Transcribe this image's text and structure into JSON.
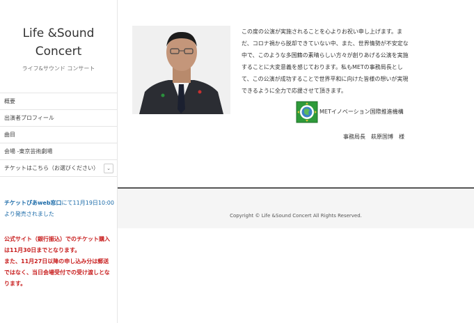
{
  "site": {
    "title": "Life &Sound Concert",
    "subtitle": "ライフ&サウンド コンサート"
  },
  "menu": {
    "items": [
      {
        "label": "概要"
      },
      {
        "label": "出演者プロフィール"
      },
      {
        "label": "曲目"
      },
      {
        "label": "会場 -東京芸術劇場"
      },
      {
        "label": "チケットはこちら（お選びください）",
        "toggle": "⌄"
      }
    ]
  },
  "notice_ticketpia": {
    "bold": "チケットぴあweb窓口",
    "rest": "にて11月19日10:00より発売されました"
  },
  "notice_official": {
    "line1": "公式サイト（銀行振込）でのチケット購入は11月30日までとなります。",
    "line2": "また、11月27日以降の申し込み分は郵送ではなく、当日会場受付での受け渡しとなります。"
  },
  "message": {
    "text": "この度の公演が実施されることを心よりお祝い申し上げます。まだ、コロナ禍から脱却できていない中、また、世界情勢が不安定な中で、このような多国籍の素晴らしい方々が創りあげる公演を実施することに大変意義を感じております。私もMETの事務局長として、この公演が成功することで世界平和に向けた皆様の想いが実現できるように全力で応援させて頂きます。",
    "org_name": "METイノベーション国際推進機構",
    "signature": "事務局長　萩原国博　様"
  },
  "footer": {
    "copyright": "Copyright © Life &Sound Concert All Rights Reserved."
  }
}
